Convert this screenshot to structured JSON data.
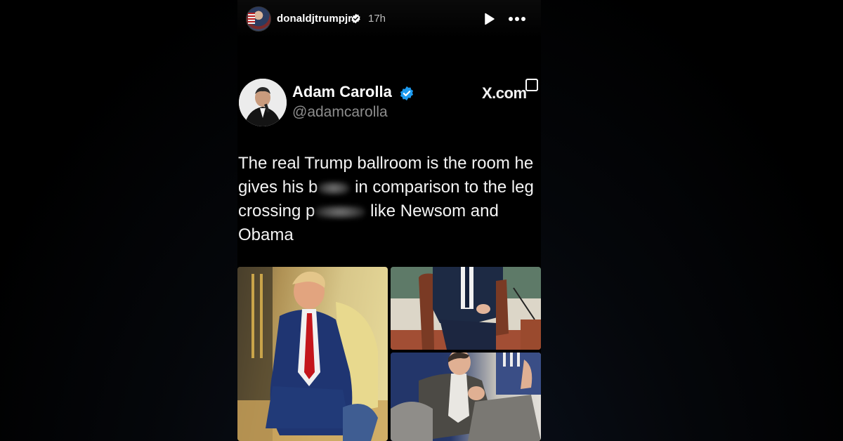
{
  "story": {
    "username": "donaldjtrumpjr",
    "time_ago": "17h",
    "icons": {
      "avatar": "profile-avatar-icon",
      "verified": "verified-badge-icon",
      "play": "play-icon",
      "more": "more-options-icon"
    }
  },
  "tweet": {
    "author_name": "Adam Carolla",
    "handle": "@adamcarolla",
    "source": "X.com",
    "text_lines": [
      "The real Trump ballroom is the room he",
      [
        "gives his b",
        "[blurred]",
        " in comparison to the leg"
      ],
      [
        "crossing p",
        "[blurred]",
        " like Newsom and"
      ],
      "Obama"
    ],
    "line1": "The real Trump ballroom is the room he",
    "line2_a": "gives his b",
    "line2_b": "in comparison to the leg",
    "line3_a": "crossing p",
    "line3_b": "like Newsom and",
    "line4": "Obama"
  },
  "colors": {
    "background": "#000000",
    "verified_blue": "#1d9bf0",
    "handle_gray": "#8d8d8d"
  }
}
